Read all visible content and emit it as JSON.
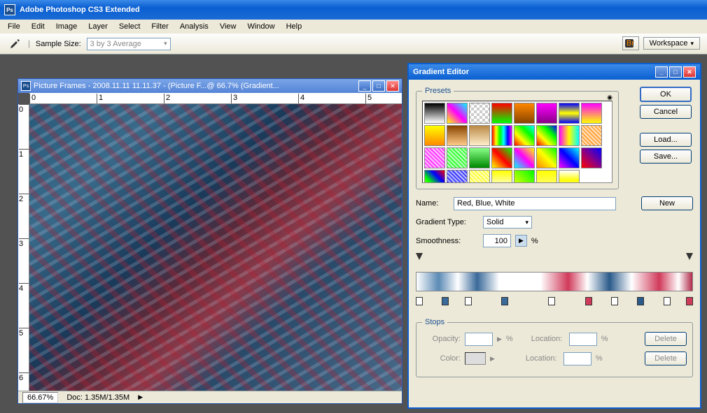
{
  "app": {
    "title": "Adobe Photoshop CS3 Extended",
    "icon": "Ps"
  },
  "menu": [
    "File",
    "Edit",
    "Image",
    "Layer",
    "Select",
    "Filter",
    "Analysis",
    "View",
    "Window",
    "Help"
  ],
  "options": {
    "sampleLabel": "Sample Size:",
    "sampleValue": "3 by 3 Average",
    "workspaceLabel": "Workspace"
  },
  "doc": {
    "title": "Picture Frames - 2008.11.11 11.11.37 - (Picture F...@ 66.7% (Gradient...",
    "zoom": "66.67%",
    "docinfo": "Doc: 1.35M/1.35M",
    "rulerH": [
      0,
      1,
      2,
      3,
      4,
      5
    ],
    "rulerV": [
      0,
      1,
      2,
      3,
      4,
      5,
      6
    ]
  },
  "dialog": {
    "title": "Gradient Editor",
    "presetsLabel": "Presets",
    "nameLabel": "Name:",
    "nameValue": "Red, Blue, White",
    "gradTypeLabel": "Gradient Type:",
    "gradTypeValue": "Solid",
    "smoothLabel": "Smoothness:",
    "smoothValue": "100",
    "percent": "%",
    "stopsLabel": "Stops",
    "opacityLabel": "Opacity:",
    "colorLabel": "Color:",
    "locationLabel": "Location:",
    "buttons": {
      "ok": "OK",
      "cancel": "Cancel",
      "load": "Load...",
      "save": "Save...",
      "new": "New",
      "delete": "Delete"
    }
  },
  "swatches": [
    "linear-gradient(#000,#fff)",
    "linear-gradient(45deg,#ff0,#f0f,#0ff)",
    "repeating-conic-gradient(#ccc 0 25%,#fff 0 50%) 50%/8px 8px",
    "linear-gradient(#f00,#0f0)",
    "linear-gradient(#f80,#840)",
    "linear-gradient(#f0f,#808)",
    "linear-gradient(#00f,#ff0,#00f)",
    "linear-gradient(#f0f,#ff0)",
    "linear-gradient(#ff0,#f80)",
    "linear-gradient(#840,#fc8)",
    "linear-gradient(#b84,#fec)",
    "linear-gradient(90deg,#f00,#ff0,#0f0,#0ff,#00f,#f0f)",
    "linear-gradient(45deg,#f00,#ff0,#0f0,#0ff)",
    "linear-gradient(45deg,#f00,#ff0,#0f0,#00f)",
    "linear-gradient(90deg,#f0f,#ff0,#0ff)",
    "repeating-linear-gradient(45deg,#f80,#fff 4px)",
    "repeating-linear-gradient(45deg,#f0f,#fff 4px)",
    "repeating-linear-gradient(45deg,#0f0,#fff 4px)",
    "linear-gradient(#8f8,#080)",
    "linear-gradient(45deg,#ff0,#f00,#0f0)",
    "linear-gradient(45deg,#0ff,#f0f,#ff0)",
    "linear-gradient(45deg,#f80,#ff0,#0f0)",
    "linear-gradient(45deg,#f0f,#00f,#0ff)",
    "linear-gradient(45deg,#f00,#808,#00f)",
    "linear-gradient(45deg,#ff0,#0f0,#00f,#f00)",
    "repeating-linear-gradient(45deg,#00f,#fff 4px)",
    "repeating-linear-gradient(45deg,#ff0,#fff 4px)",
    "linear-gradient(#ff0,#fff)",
    "linear-gradient(45deg,#ff0,#0f0)",
    "linear-gradient(#ff0,#ff8)",
    "linear-gradient(#fff,#ff0,#fff)"
  ]
}
